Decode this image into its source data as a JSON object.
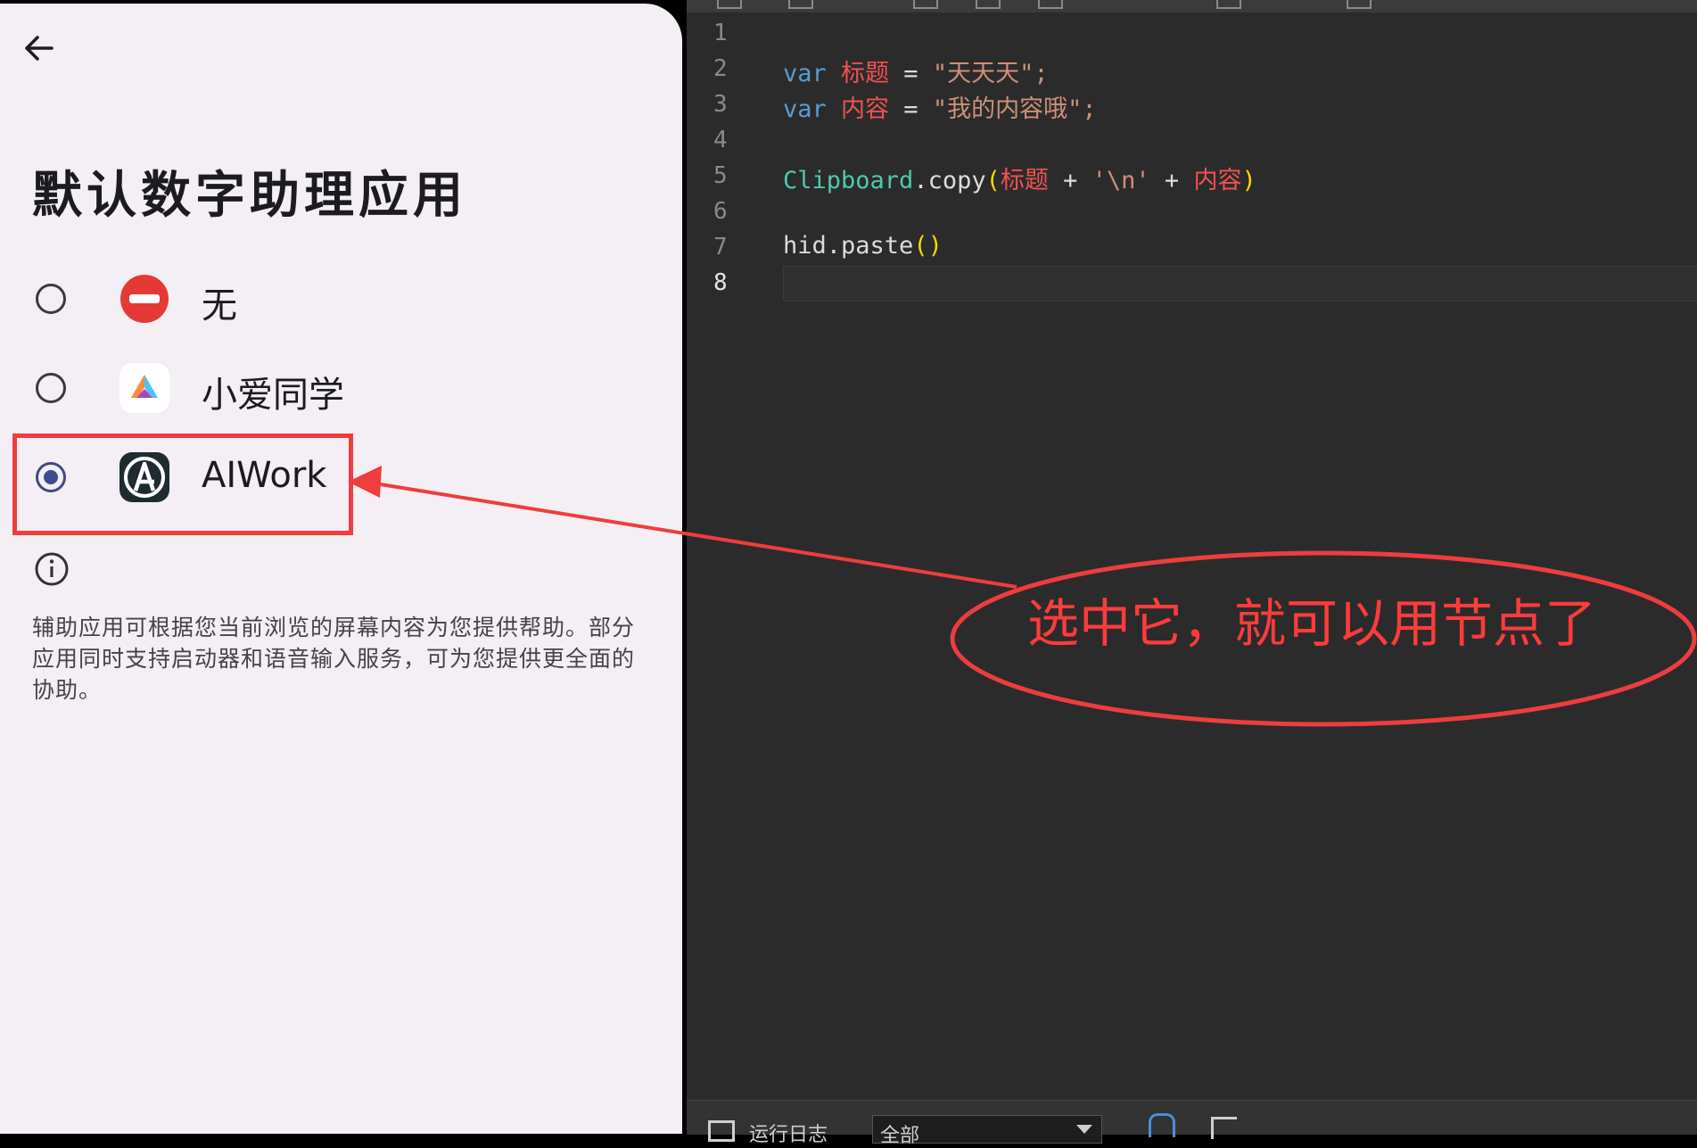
{
  "phone": {
    "title": "默认数字助理应用",
    "options": [
      {
        "label": "无",
        "icon": "none-icon",
        "selected": false
      },
      {
        "label": "小爱同学",
        "icon": "xiaoai-icon",
        "selected": false
      },
      {
        "label": "AIWork",
        "icon": "aiwork-icon",
        "selected": true
      }
    ],
    "description": "辅助应用可根据您当前浏览的屏幕内容为您提供帮助。部分应用同时支持启动器和语音输入服务，可为您提供更全面的协助。"
  },
  "editor": {
    "line_numbers": [
      "1",
      "2",
      "3",
      "4",
      "5",
      "6",
      "7",
      "8"
    ],
    "code": {
      "l2": {
        "kw": "var",
        "name": "标题",
        "eq": " = ",
        "value": "\"天天天\";"
      },
      "l3": {
        "kw": "var",
        "name": "内容",
        "eq": " = ",
        "value": "\"我的内容哦\";"
      },
      "l5": {
        "cls": "Clipboard",
        "method": ".copy",
        "open": "(",
        "a": "标题",
        "plus1": " + ",
        "nl": "'\\n'",
        "plus2": " + ",
        "b": "内容",
        "close": ")"
      },
      "l7": {
        "fn": "hid.paste",
        "parens": "()"
      }
    },
    "status": {
      "log_label": "运行日志",
      "filter_value": "全部"
    }
  },
  "annotation": {
    "text": "选中它，就可以用节点了",
    "color": "#ff3b3b"
  }
}
